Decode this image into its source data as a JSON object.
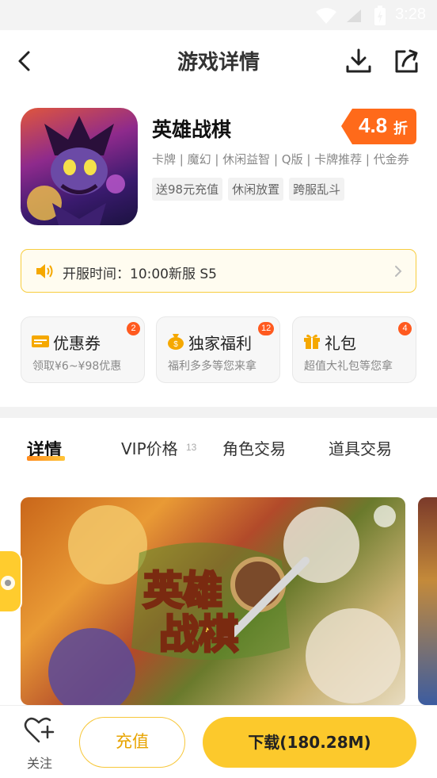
{
  "status_bar": {
    "time": "3:28"
  },
  "header": {
    "title": "游戏详情"
  },
  "game": {
    "name": "英雄战棋",
    "discount_value": "4.8",
    "discount_unit": "折",
    "categories": "卡牌 | 魔幻 | 休闲益智 | Q版 | 卡牌推荐 | 代金券",
    "tags": [
      "送98元充值",
      "休闲放置",
      "跨服乱斗"
    ]
  },
  "server": {
    "text": "开服时间：10:00新服 S5"
  },
  "cards": [
    {
      "title": "优惠券",
      "subtitle": "领取¥6~¥98优惠",
      "badge": "2",
      "icon": "coupon-icon"
    },
    {
      "title": "独家福利",
      "subtitle": "福利多多等您来拿",
      "badge": "12",
      "icon": "money-bag-icon"
    },
    {
      "title": "礼包",
      "subtitle": "超值大礼包等您拿",
      "badge": "4",
      "icon": "gift-icon"
    }
  ],
  "tabs": [
    {
      "label": "详情"
    },
    {
      "label": "VIP价格",
      "count": "13"
    },
    {
      "label": "角色交易"
    },
    {
      "label": "道具交易"
    }
  ],
  "screenshot": {
    "logo_line1": "英雄",
    "logo_line2": "战棋"
  },
  "bottom": {
    "follow_label": "关注",
    "recharge_label": "充值",
    "download_label": "下载(180.28M)"
  },
  "colors": {
    "accent": "#fcc92c",
    "discount": "#ff6a1a",
    "badge": "#ff5a1f"
  }
}
